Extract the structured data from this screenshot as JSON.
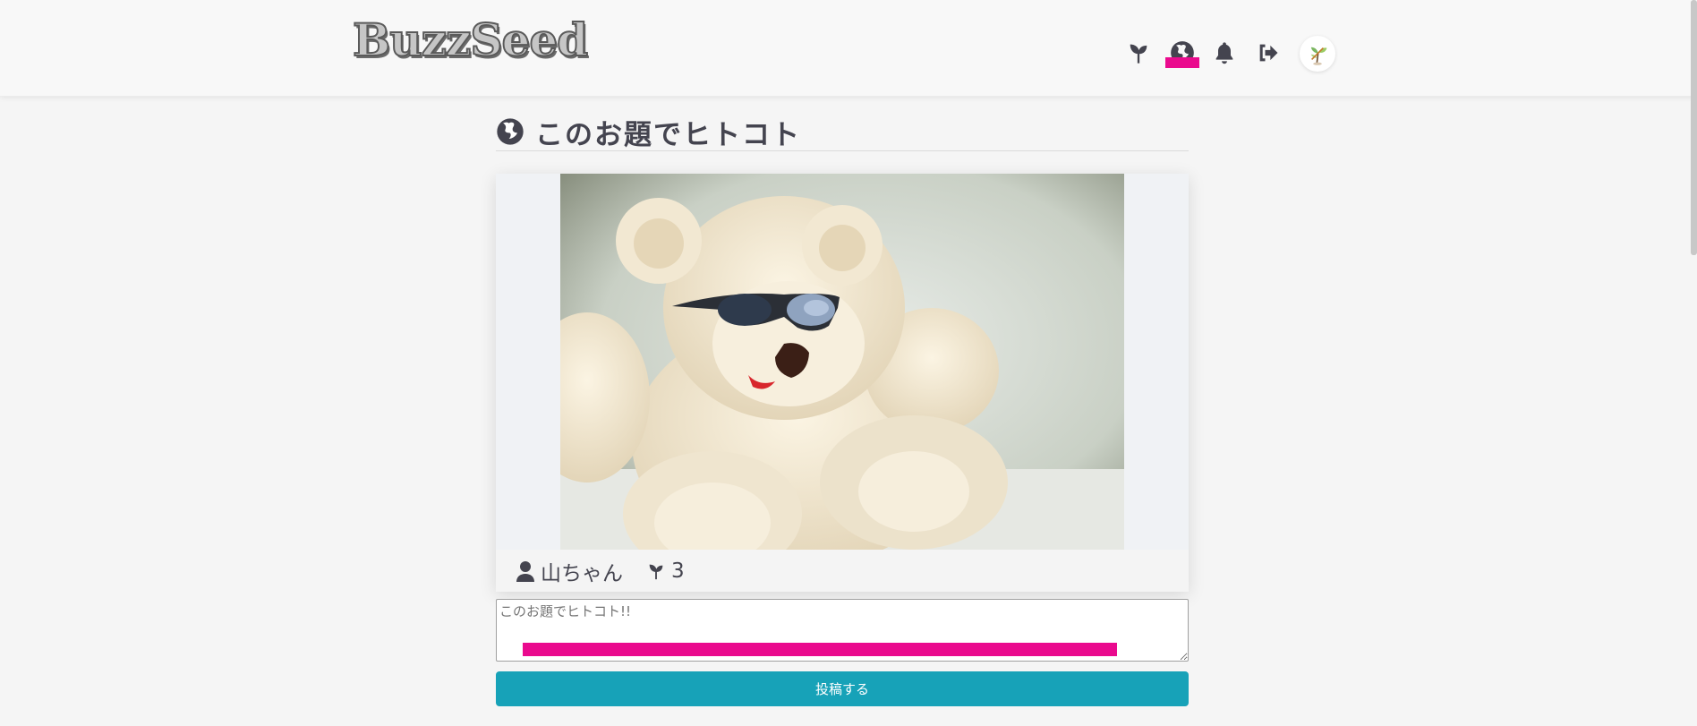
{
  "header": {
    "logo": "BuzzSeed",
    "nav": [
      {
        "icon": "seedling-icon"
      },
      {
        "icon": "globe-icon",
        "active": true
      },
      {
        "icon": "bell-icon"
      },
      {
        "icon": "sign-out-icon"
      }
    ],
    "avatar_icon": "plant-sprout-avatar"
  },
  "main": {
    "title": "このお題でヒトコト",
    "title_icon": "globe-icon",
    "photo": {
      "subject": "teddy-bear-with-sunglasses"
    },
    "author": "山ちゃん",
    "seed_count": "3",
    "comment_placeholder": "このお題でヒトコト!!",
    "submit_label": "投稿する"
  },
  "colors": {
    "accent": "#17a2b8",
    "highlight": "#ea0a8e",
    "icon": "#44444f",
    "navbar_bg": "#f8f8f8",
    "page_bg": "#f5f5f5"
  }
}
